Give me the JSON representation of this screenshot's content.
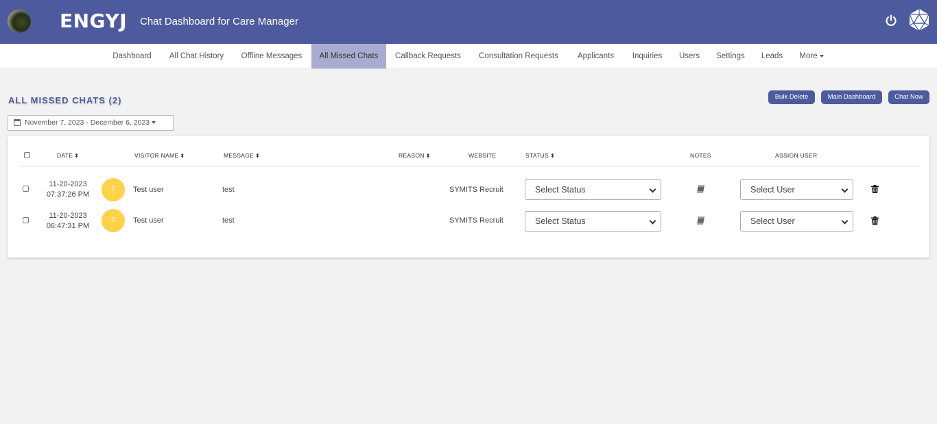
{
  "header": {
    "brand": "ENGYJ",
    "subtitle": "Chat Dashboard for Care Manager",
    "power_icon": "power-icon",
    "logo_icon": "d20-dice-icon"
  },
  "nav": {
    "items": [
      {
        "label": "Dashboard"
      },
      {
        "label": "All Chat History"
      },
      {
        "label": "Offline Messages"
      },
      {
        "label": "All Missed Chats"
      },
      {
        "label": "Callback Requests"
      },
      {
        "label": "Consultation Requests"
      },
      {
        "label": "Applicants"
      },
      {
        "label": "Inquiries"
      },
      {
        "label": "Users"
      },
      {
        "label": "Settings"
      },
      {
        "label": "Leads"
      },
      {
        "label": "More"
      }
    ],
    "active": "All Missed Chats"
  },
  "page": {
    "title": "ALL MISSED CHATS (2)",
    "buttons": {
      "bulk_delete": "Bulk Delete",
      "main_dashboard": "Main Dashboard",
      "chat_now": "Chat Now"
    },
    "date_range": "November 7, 2023 - December 6, 2023"
  },
  "table": {
    "headers": {
      "date": "DATE",
      "visitor_name": "VISITOR NAME",
      "message": "MESSAGE",
      "reason": "REASON",
      "website": "WEBSITE",
      "status": "STATUS",
      "notes": "NOTES",
      "assign_user": "ASSIGN USER"
    },
    "rows": [
      {
        "date": "11-20-2023",
        "time": "07:37:26 PM",
        "avatar_initial": "T",
        "visitor_name": "Test user",
        "message": "test",
        "reason": "",
        "website": "SYMITS Recruit",
        "status": "Select Status",
        "assign_user": "Select User"
      },
      {
        "date": "11-20-2023",
        "time": "06:47:31 PM",
        "avatar_initial": "T",
        "visitor_name": "Test user",
        "message": "test",
        "reason": "",
        "website": "SYMITS Recruit",
        "status": "Select Status",
        "assign_user": "Select User"
      }
    ]
  },
  "colors": {
    "header_bg": "#4d5b9e",
    "nav_active_bg": "#a9acd0",
    "avatar_bg": "#ffd24a"
  }
}
